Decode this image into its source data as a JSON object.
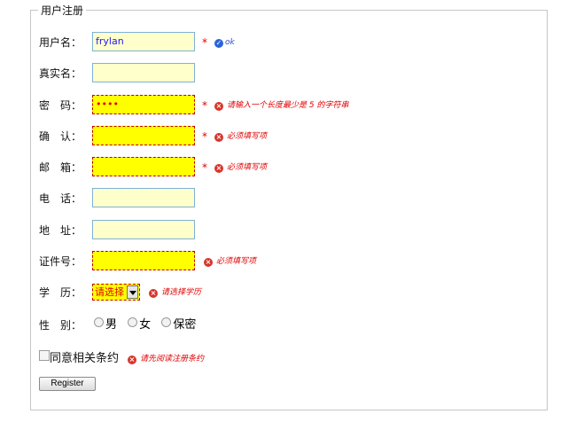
{
  "form": {
    "legend": "用户注册",
    "fields": {
      "username": {
        "label": "用户名：",
        "value": "frylan",
        "required": "*",
        "message": "ok"
      },
      "realname": {
        "label": "真实名：",
        "value": ""
      },
      "password": {
        "label": "密　码：",
        "value": "••••",
        "required": "*",
        "message": "请输入一个长度最少是 5 的字符串"
      },
      "confirm": {
        "label": "确　认：",
        "value": "",
        "required": "*",
        "message": "必须填写项"
      },
      "email": {
        "label": "邮　箱：",
        "value": "",
        "required": "*",
        "message": "必须填写项"
      },
      "phone": {
        "label": "电　话：",
        "value": ""
      },
      "address": {
        "label": "地　址：",
        "value": ""
      },
      "idnumber": {
        "label": "证件号：",
        "value": "",
        "message": "必须填写项"
      },
      "education": {
        "label": "学　历：",
        "selected": "请选择",
        "message": "请选择学历"
      },
      "gender": {
        "label": "性　别：",
        "options": [
          "男",
          "女",
          "保密"
        ]
      },
      "agree": {
        "label": "同意相关条约",
        "message": "请先阅读注册条约"
      }
    },
    "submit_label": "Register"
  },
  "icons": {
    "error": "error-circle-icon",
    "ok": "check-circle-icon"
  },
  "colors": {
    "error": "#e00000",
    "ok": "#2a4fc8",
    "invalid_bg": "#ffff00",
    "field_bg": "#ffffcc"
  }
}
